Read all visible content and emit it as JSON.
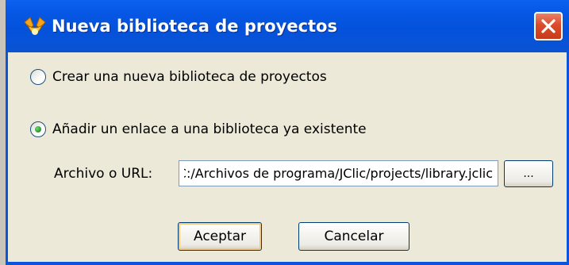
{
  "window": {
    "title": "Nueva biblioteca de proyectos",
    "icon": "jclic-app-icon",
    "close_icon": "close-icon"
  },
  "options": {
    "create_label": "Crear una nueva biblioteca de proyectos",
    "create_selected": false,
    "link_label": "Añadir un enlace a una biblioteca ya existente",
    "link_selected": true
  },
  "file_field": {
    "label": "Archivo o URL:",
    "value": "C:/Archivos de programa/JClic/projects/library.jclic",
    "visible_value": "s de programa/JClic/projects/library.jclic"
  },
  "buttons": {
    "browse_label": "...",
    "accept_label": "Aceptar",
    "cancel_label": "Cancelar"
  },
  "colors": {
    "titlebar": "#0452dc",
    "client": "#ece9d8",
    "close_button": "#dc4b2a",
    "radio_dot": "#2f9e2f"
  }
}
